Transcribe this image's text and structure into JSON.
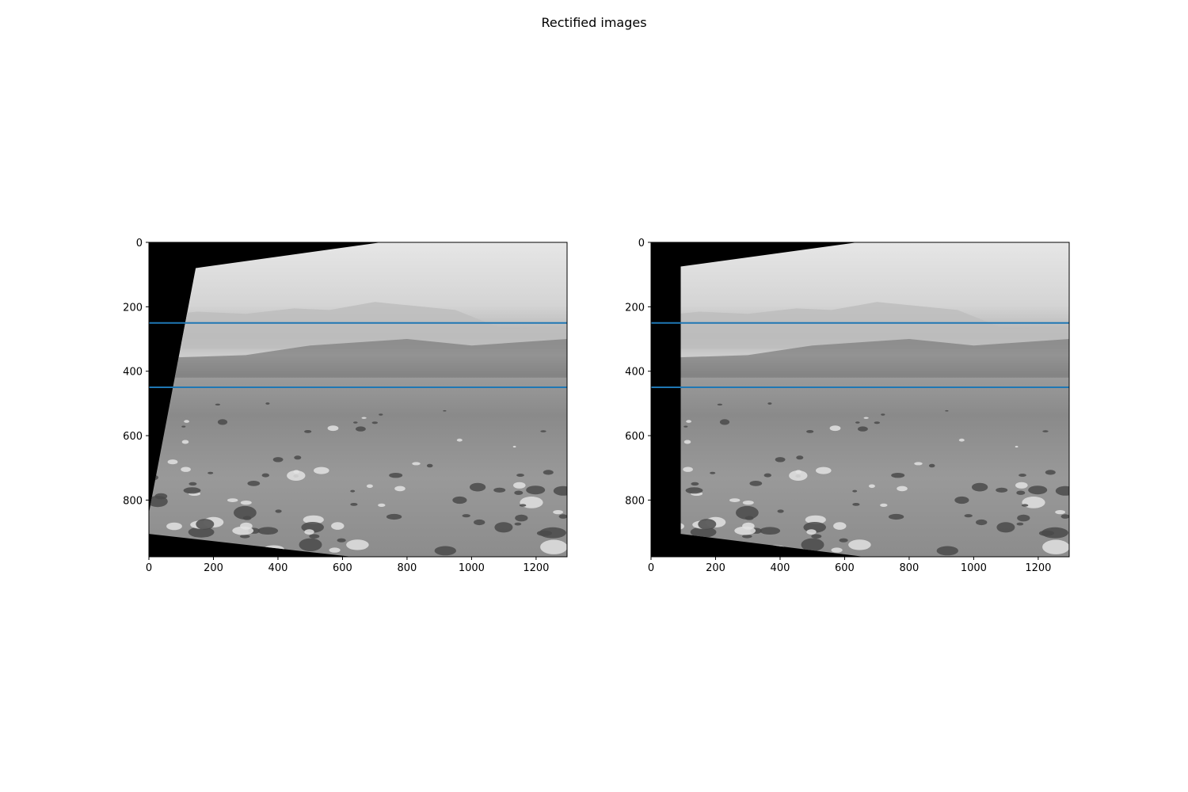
{
  "figure": {
    "title": "Rectified images"
  },
  "chart_data": [
    {
      "type": "image",
      "panel": "left",
      "xlim": [
        0,
        1296
      ],
      "ylim": [
        976,
        0
      ],
      "xticks": [
        0,
        200,
        400,
        600,
        800,
        1000,
        1200
      ],
      "yticks": [
        0,
        200,
        400,
        600,
        800
      ],
      "horizontal_lines_y": [
        250,
        450
      ],
      "line_color": "#1f77b4",
      "image": "grayscale Mars terrain, warped into a quadrilateral with black borders",
      "image_corners": [
        [
          720,
          0
        ],
        [
          1296,
          0
        ],
        [
          1296,
          770
        ],
        [
          1296,
          976
        ],
        [
          630,
          976
        ],
        [
          0,
          905
        ],
        [
          0,
          840
        ],
        [
          145,
          80
        ]
      ]
    },
    {
      "type": "image",
      "panel": "right",
      "xlim": [
        0,
        1296
      ],
      "ylim": [
        976,
        0
      ],
      "xticks": [
        0,
        200,
        400,
        600,
        800,
        1000,
        1200
      ],
      "yticks": [
        0,
        200,
        400,
        600,
        800
      ],
      "horizontal_lines_y": [
        250,
        450
      ],
      "line_color": "#1f77b4",
      "image": "grayscale Mars terrain, warped into a quadrilateral with black borders",
      "image_corners": [
        [
          640,
          0
        ],
        [
          1296,
          0
        ],
        [
          1296,
          976
        ],
        [
          660,
          976
        ],
        [
          92,
          905
        ],
        [
          92,
          75
        ]
      ]
    }
  ]
}
